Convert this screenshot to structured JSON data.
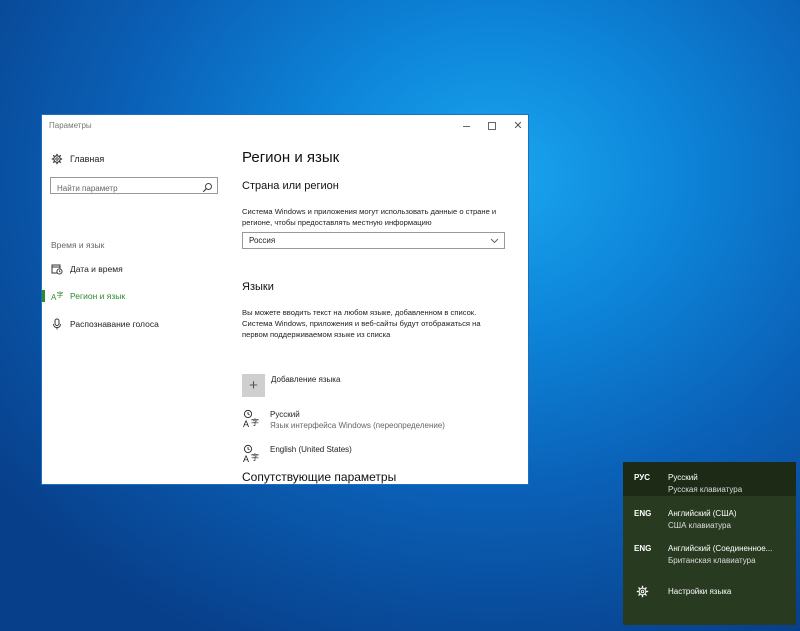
{
  "window": {
    "title": "Параметры",
    "minimize_icon": "minimize-icon",
    "maximize_icon": "maximize-icon",
    "close_glyph": "✕"
  },
  "sidebar": {
    "home_label": "Главная",
    "search_placeholder": "Найти параметр",
    "section_label": "Время и язык",
    "items": [
      {
        "label": "Дата и время",
        "icon": "calendar-clock-icon",
        "active": false
      },
      {
        "label": "Регион и язык",
        "icon": "region-language-icon",
        "active": true
      },
      {
        "label": "Распознавание голоса",
        "icon": "microphone-icon",
        "active": false
      }
    ]
  },
  "content": {
    "page_title": "Регион и язык",
    "country_heading": "Страна или регион",
    "country_description": "Система Windows и приложения могут использовать данные о стране и регионе, чтобы предоставлять местную информацию",
    "country_value": "Россия",
    "languages_heading": "Языки",
    "languages_description": "Вы можете вводить текст на любом языке, добавленном в список. Система Windows, приложения и веб-сайты будут отображаться на первом поддерживаемом языке из списка",
    "add_language_label": "Добавление языка",
    "add_language_glyph": "+",
    "languages": [
      {
        "name": "Русский",
        "sub": "Язык интерфейса Windows (переопределение)"
      },
      {
        "name": "English (United States)",
        "sub": ""
      }
    ],
    "related_heading": "Сопутствующие параметры"
  },
  "flyout": {
    "items": [
      {
        "code": "РУС",
        "name": "Русский",
        "keyboard": "Русская клавиатура",
        "selected": true
      },
      {
        "code": "ENG",
        "name": "Английский (США)",
        "keyboard": "США клавиатура",
        "selected": false
      },
      {
        "code": "ENG",
        "name": "Английский (Соединенное...",
        "keyboard": "Британская клавиатура",
        "selected": false
      }
    ],
    "settings_label": "Настройки языка"
  },
  "colors": {
    "accent_green": "#2d8a2d",
    "flyout_bg": "#283a1f",
    "flyout_selected": "#1c2a16",
    "desktop_blue": "#0d84d8"
  }
}
